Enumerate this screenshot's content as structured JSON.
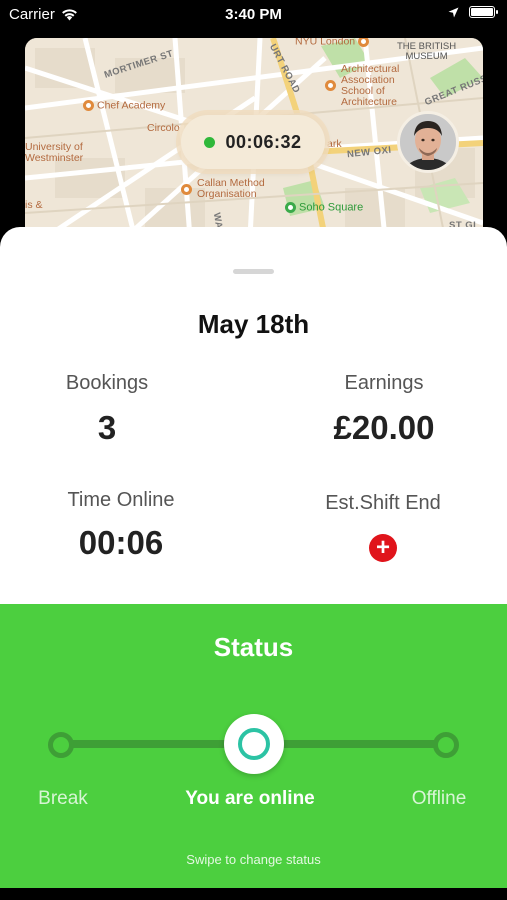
{
  "status_bar": {
    "carrier": "Carrier",
    "time": "3:40 PM"
  },
  "map": {
    "timer": "00:06:32",
    "labels": {
      "nyu_london": "NYU London",
      "british_museum": "THE BRITISH\nMUSEUM",
      "mortimer_st": "MORTIMER ST",
      "court_road": "URT ROAD",
      "chef_academy": "Chef Academy",
      "architectural": "Architectural\nAssociation\nSchool of\nArchitecture",
      "great_russell": "GREAT RUSS",
      "circolo": "Circolo",
      "university": "University of\nWestminster",
      "ark": "ark",
      "new_oxford": "NEW OXI",
      "callan": "Callan Method\nOrganisation",
      "soho_square": "Soho Square",
      "ris": "is &",
      "wa": "WA",
      "stg": "ST GI"
    }
  },
  "sheet": {
    "date": "May 18th",
    "bookings_label": "Bookings",
    "bookings_value": "3",
    "earnings_label": "Earnings",
    "earnings_value": "£20.00",
    "time_online_label": "Time Online",
    "time_online_value": "00:06",
    "shift_end_label": "Est.Shift End",
    "add_glyph": "+"
  },
  "status": {
    "title": "Status",
    "options": {
      "break": "Break",
      "online": "You are online",
      "offline": "Offline"
    },
    "hint": "Swipe to change status",
    "accent": "#4ccf3f",
    "knob_ring": "#2cc3a4"
  }
}
